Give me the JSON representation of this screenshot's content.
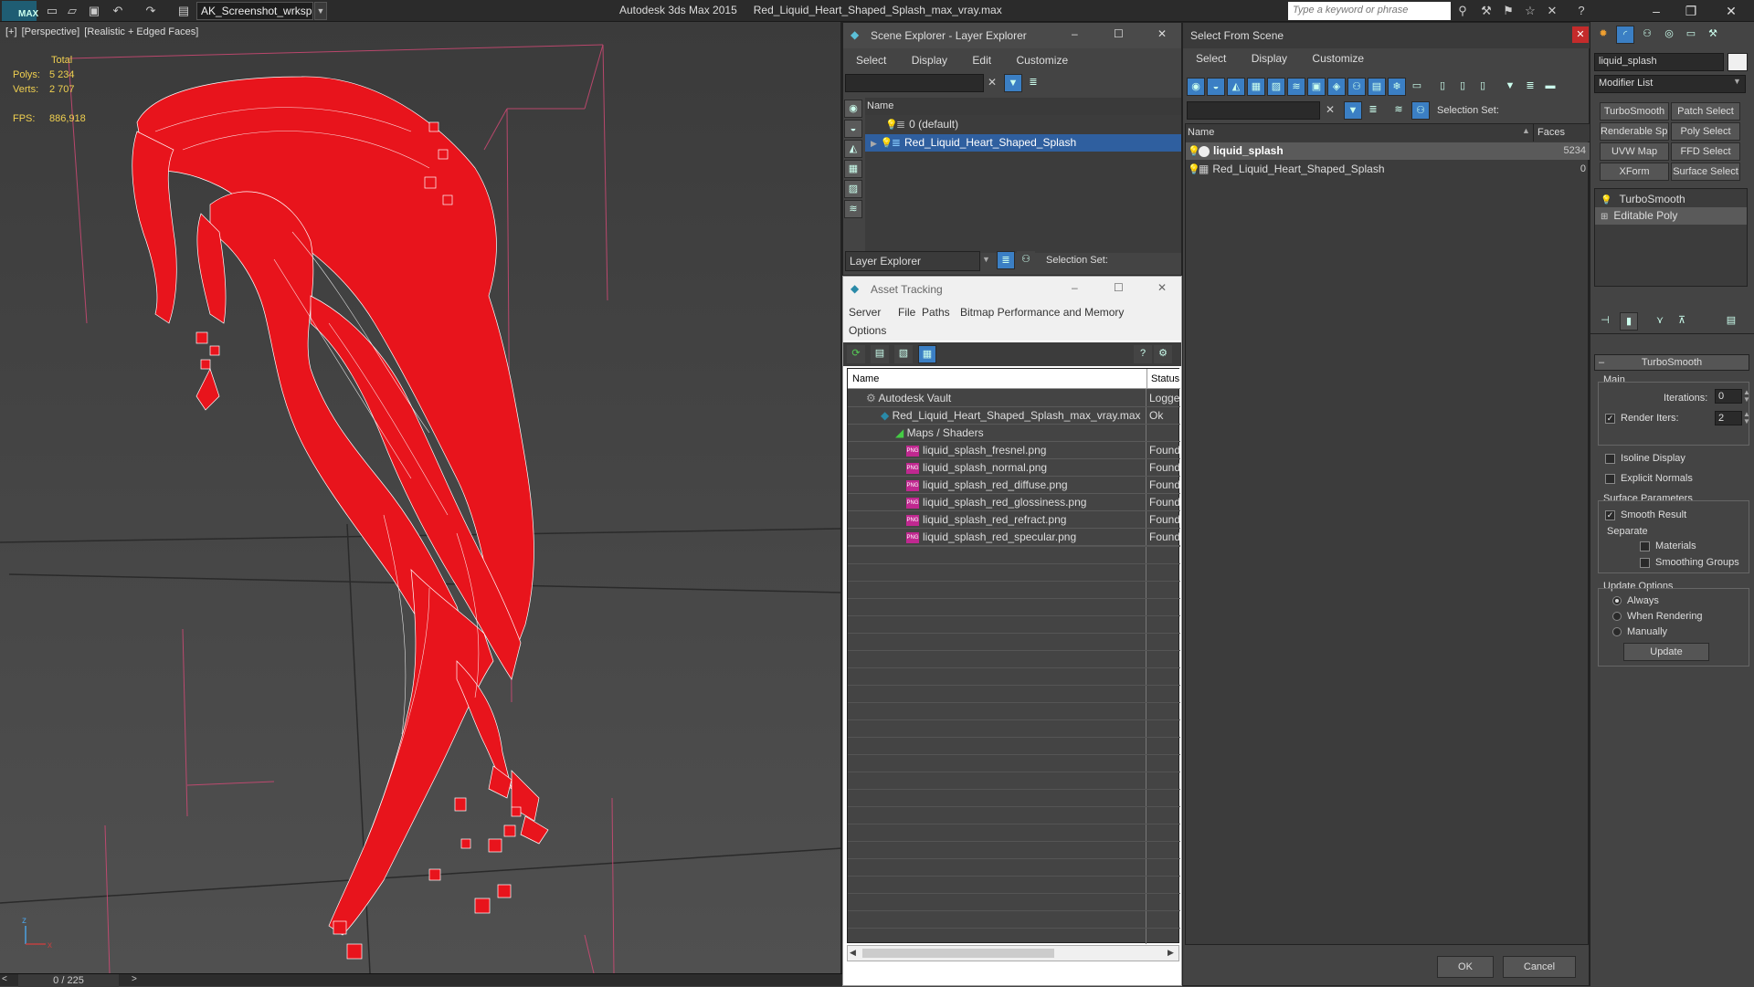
{
  "titlebar": {
    "logo": "MAX",
    "workspace": "AK_Screenshot_wrksp",
    "app_name": "Autodesk 3ds Max  2015",
    "file_name": "Red_Liquid_Heart_Shaped_Splash_max_vray.max",
    "search_placeholder": "Type a keyword or phrase"
  },
  "viewport": {
    "label_plus": "[+]",
    "label_view": "[Perspective]",
    "label_shading": "[Realistic + Edged Faces]",
    "stats_header": "Total",
    "polys_label": "Polys:",
    "polys_value": "5 234",
    "verts_label": "Verts:",
    "verts_value": "2 707",
    "fps_label": "FPS:",
    "fps_value": "886,918",
    "frame_counter": "0 / 225",
    "axis_z": "z",
    "axis_x": "x",
    "mesh_color": "#e8141c"
  },
  "scene_explorer": {
    "title": "Scene Explorer - Layer Explorer",
    "menu": [
      "Select",
      "Display",
      "Edit",
      "Customize"
    ],
    "col_name": "Name",
    "rows": [
      "0 (default)",
      "Red_Liquid_Heart_Shaped_Splash"
    ],
    "footer_dropdown": "Layer Explorer",
    "selection_set_label": "Selection Set:"
  },
  "asset_tracking": {
    "title": "Asset Tracking",
    "menu": [
      "Server",
      "File",
      "Paths",
      "Bitmap Performance and Memory"
    ],
    "menu2": "Options",
    "col_name": "Name",
    "col_status": "Status",
    "rows": [
      {
        "name": "Autodesk Vault",
        "status": "Logged"
      },
      {
        "name": "Red_Liquid_Heart_Shaped_Splash_max_vray.max",
        "status": "Ok"
      },
      {
        "name": "Maps / Shaders",
        "status": ""
      },
      {
        "name": "liquid_splash_fresnel.png",
        "status": "Found"
      },
      {
        "name": "liquid_splash_normal.png",
        "status": "Found"
      },
      {
        "name": "liquid_splash_red_diffuse.png",
        "status": "Found"
      },
      {
        "name": "liquid_splash_red_glossiness.png",
        "status": "Found"
      },
      {
        "name": "liquid_splash_red_refract.png",
        "status": "Found"
      },
      {
        "name": "liquid_splash_red_specular.png",
        "status": "Found"
      }
    ]
  },
  "select_from_scene": {
    "title": "Select From Scene",
    "menu": [
      "Select",
      "Display",
      "Customize"
    ],
    "selection_set_label": "Selection Set:",
    "col_name": "Name",
    "col_faces": "Faces",
    "rows": [
      {
        "name": "liquid_splash",
        "faces": "5234"
      },
      {
        "name": "Red_Liquid_Heart_Shaped_Splash",
        "faces": "0"
      }
    ],
    "ok": "OK",
    "cancel": "Cancel"
  },
  "command_panel": {
    "object_name": "liquid_splash",
    "modifier_list": "Modifier List",
    "buttons": [
      "TurboSmooth",
      "Patch Select",
      "Renderable Spline",
      "Poly Select",
      "UVW Map",
      "FFD Select",
      "XForm",
      "Surface Select"
    ],
    "stack": [
      "TurboSmooth",
      "Editable Poly"
    ],
    "rollout_title": "TurboSmooth",
    "main_label": "Main",
    "iterations_label": "Iterations:",
    "iterations_value": "0",
    "render_iters_label": "Render Iters:",
    "render_iters_value": "2",
    "isoline": "Isoline Display",
    "explicit_normals": "Explicit Normals",
    "surface_params": "Surface Parameters",
    "smooth_result": "Smooth Result",
    "separate": "Separate",
    "materials": "Materials",
    "smoothing_groups": "Smoothing Groups",
    "update_options": "Update Options",
    "always": "Always",
    "when_rendering": "When Rendering",
    "manually": "Manually",
    "update_btn": "Update"
  }
}
